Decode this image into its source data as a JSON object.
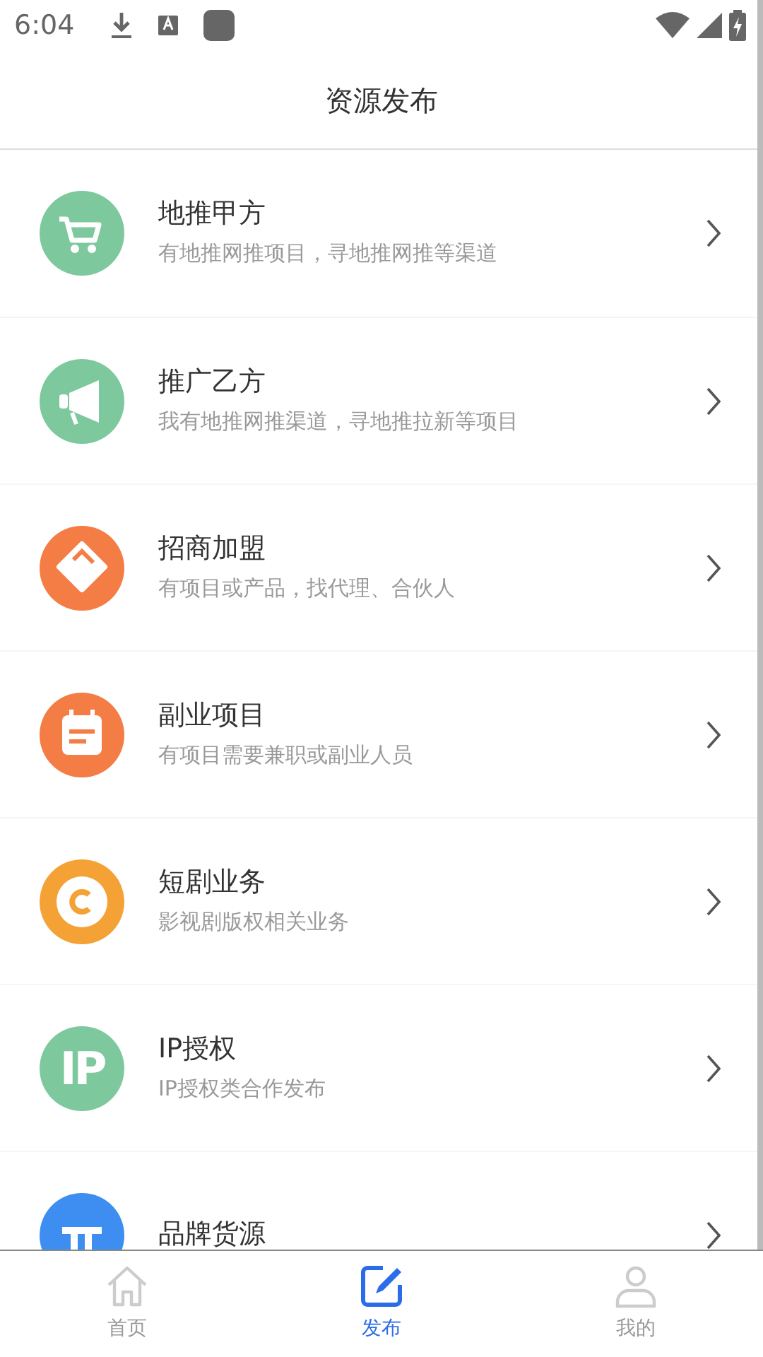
{
  "status_bar": {
    "time": "6:04"
  },
  "header": {
    "title": "资源发布"
  },
  "items": [
    {
      "kind": "cart",
      "color": "#7ec89d",
      "title": "地推甲方",
      "subtitle": "有地推网推项目，寻地推网推等渠道"
    },
    {
      "kind": "megaphone",
      "color": "#7ec89d",
      "title": "推广乙方",
      "subtitle": "我有地推网推渠道，寻地推拉新等项目"
    },
    {
      "kind": "tag",
      "color": "#f47c45",
      "title": "招商加盟",
      "subtitle": "有项目或产品，找代理、合伙人"
    },
    {
      "kind": "calendar",
      "color": "#f47c45",
      "title": "副业项目",
      "subtitle": "有项目需要兼职或副业人员"
    },
    {
      "kind": "copyright",
      "color": "#f4a236",
      "title": "短剧业务",
      "subtitle": "影视剧版权相关业务"
    },
    {
      "kind": "text",
      "color": "#7ec89d",
      "icon_text": "IP",
      "title": "IP授权",
      "subtitle": "IP授权类合作发布"
    },
    {
      "kind": "logo",
      "color": "#3d8ef0",
      "title": "品牌货源"
    }
  ],
  "tab_bar": [
    {
      "kind": "home",
      "label": "首页",
      "selected": false
    },
    {
      "kind": "edit",
      "label": "发布",
      "selected": true
    },
    {
      "kind": "person",
      "label": "我的",
      "selected": false
    }
  ]
}
